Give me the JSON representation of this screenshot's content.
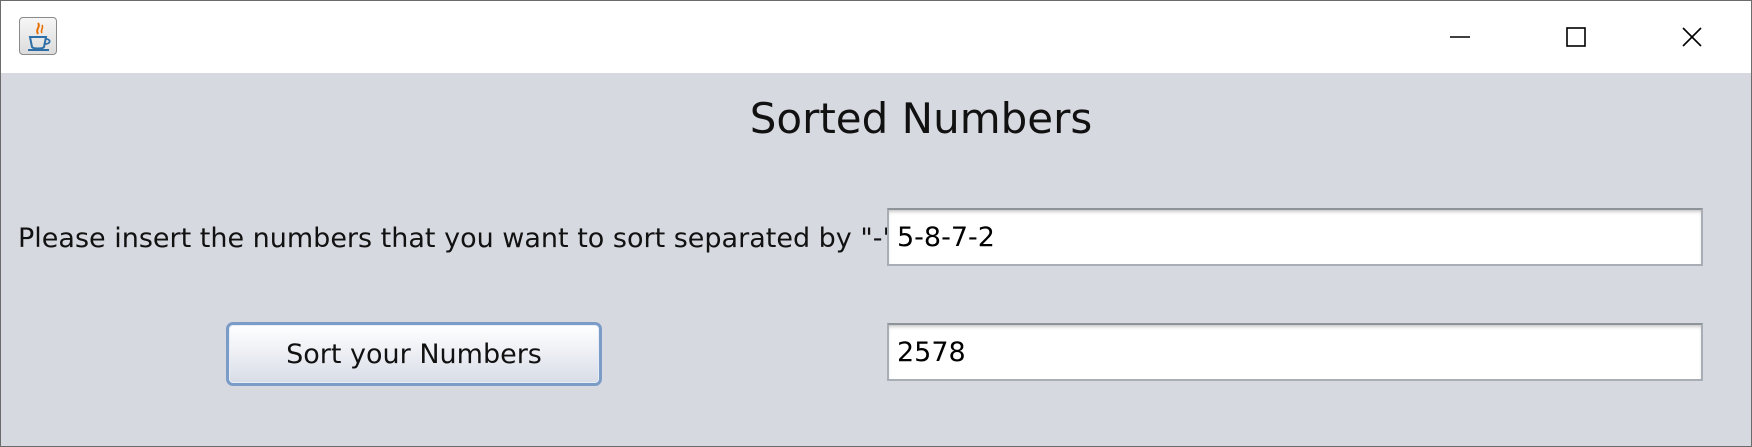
{
  "window": {
    "title": ""
  },
  "main": {
    "heading": "Sorted Numbers",
    "input_label": "Please insert the numbers that you want to sort separated by \"-\"",
    "input_value": "5-8-7-2",
    "sort_button_label": "Sort your Numbers",
    "output_value": "2578"
  },
  "icons": {
    "app": "java-coffee-cup-icon",
    "minimize": "minimize-icon",
    "maximize": "maximize-icon",
    "close": "close-icon"
  },
  "colors": {
    "content_background": "#d6d9e0",
    "button_border": "#7a9cc6"
  }
}
